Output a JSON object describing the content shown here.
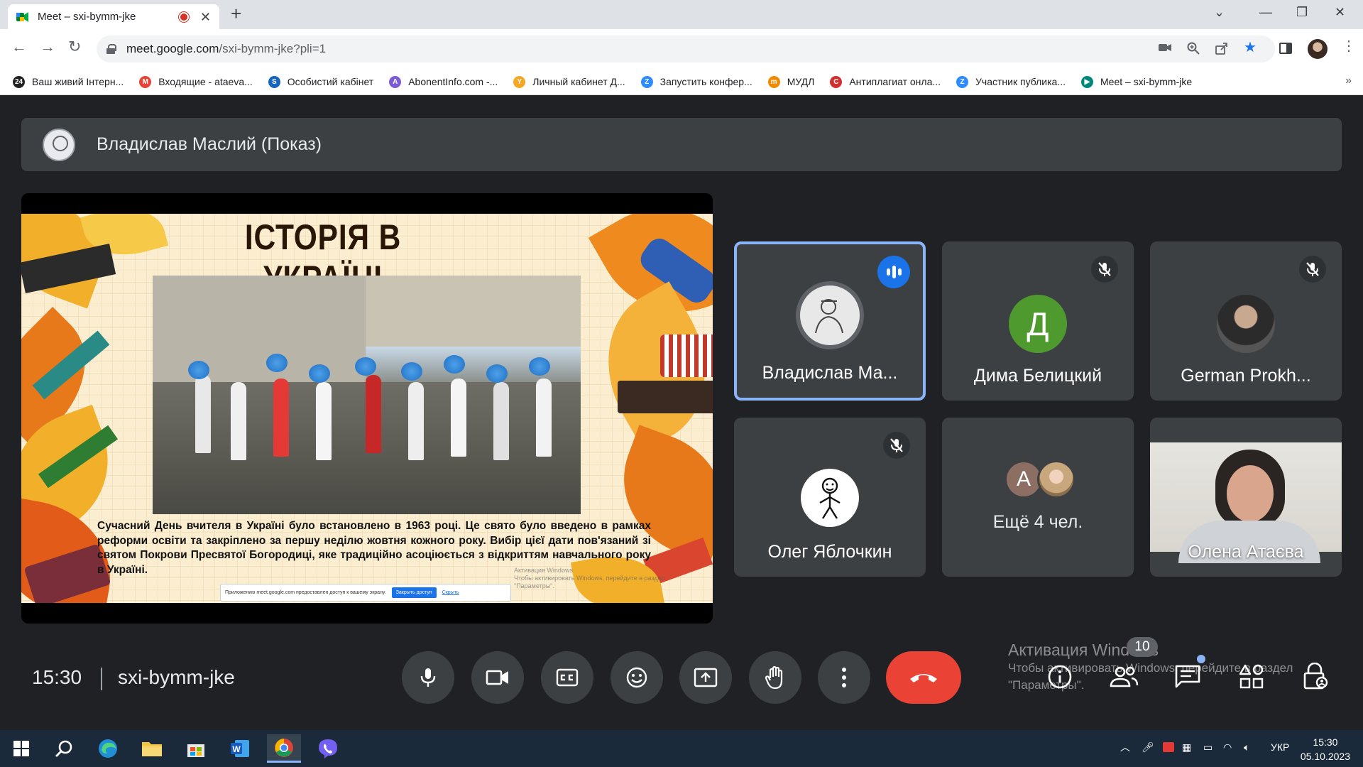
{
  "browser": {
    "tab_title": "Meet – sxi-bymm-jke",
    "url_host": "meet.google.com",
    "url_path": "/sxi-bymm-jke?pli=1",
    "bookmarks": [
      {
        "label": "Ваш живий Інтерн...",
        "icon": "24",
        "color": "#222222"
      },
      {
        "label": "Входящие - ataeva...",
        "icon": "M",
        "color": "#ea4335"
      },
      {
        "label": "Особистий кабінет",
        "icon": "S",
        "color": "#1565c0"
      },
      {
        "label": "AbonentInfo.com -...",
        "icon": "A",
        "color": "#7b5cd6"
      },
      {
        "label": "Личный кабинет Д...",
        "icon": "Y",
        "color": "#f5a623"
      },
      {
        "label": "Запустить конфер...",
        "icon": "Z",
        "color": "#2d8cff"
      },
      {
        "label": "МУДЛ",
        "icon": "m",
        "color": "#f08a00"
      },
      {
        "label": "Антиплагиат онла...",
        "icon": "C",
        "color": "#d32f2f"
      },
      {
        "label": "Участник публика...",
        "icon": "Z",
        "color": "#2d8cff"
      },
      {
        "label": "Meet – sxi-bymm-jke",
        "icon": "▶",
        "color": "#00897b"
      }
    ]
  },
  "meet": {
    "presenter_label": "Владислав Маслий (Показ)",
    "slide": {
      "title": "ІСТОРІЯ В УКРАЇНІ",
      "body": "Сучасний День вчителя в Україні було встановлено в 1963 році. Це свято було введено в рамках реформи освіти та закріплено за першу неділю жовтня кожного року. Вибір цієї дати пов'язаний зі святом Покрови Пресвятої Богородиці, яке традиційно асоціюється з відкриттям навчального року в Україні.",
      "share_notice": "Приложению meet.google.com предоставлен доступ к вашему экрану.",
      "share_stop": "Закрыть доступ",
      "share_hide": "Скрыть",
      "watermark_line1": "Активация Windows",
      "watermark_line2": "Чтобы активировать Windows, перейдите в раздел",
      "watermark_line3": "\"Параметры\"."
    },
    "participants": [
      {
        "name": "Владислав Ма...",
        "speaking": true
      },
      {
        "name": "Дима Белицкий",
        "letter": "Д",
        "color": "#4e9a2f",
        "muted": true
      },
      {
        "name": "German Prokh...",
        "muted": true
      },
      {
        "name": "Олег Яблочкин",
        "muted": true
      },
      {
        "more_label": "Ещё 4 чел.",
        "letter": "А",
        "color": "#8d6e63"
      },
      {
        "name": "Олена Атаєва"
      }
    ],
    "clock": "15:30",
    "meeting_code": "sxi-bymm-jke",
    "people_count": "10",
    "activation_title": "Активация Windows",
    "activation_line1": "Чтобы активировать Windows, перейдите в раздел",
    "activation_line2": "\"Параметры\"."
  },
  "taskbar": {
    "lang": "УКР",
    "time": "15:30",
    "date": "05.10.2023"
  }
}
